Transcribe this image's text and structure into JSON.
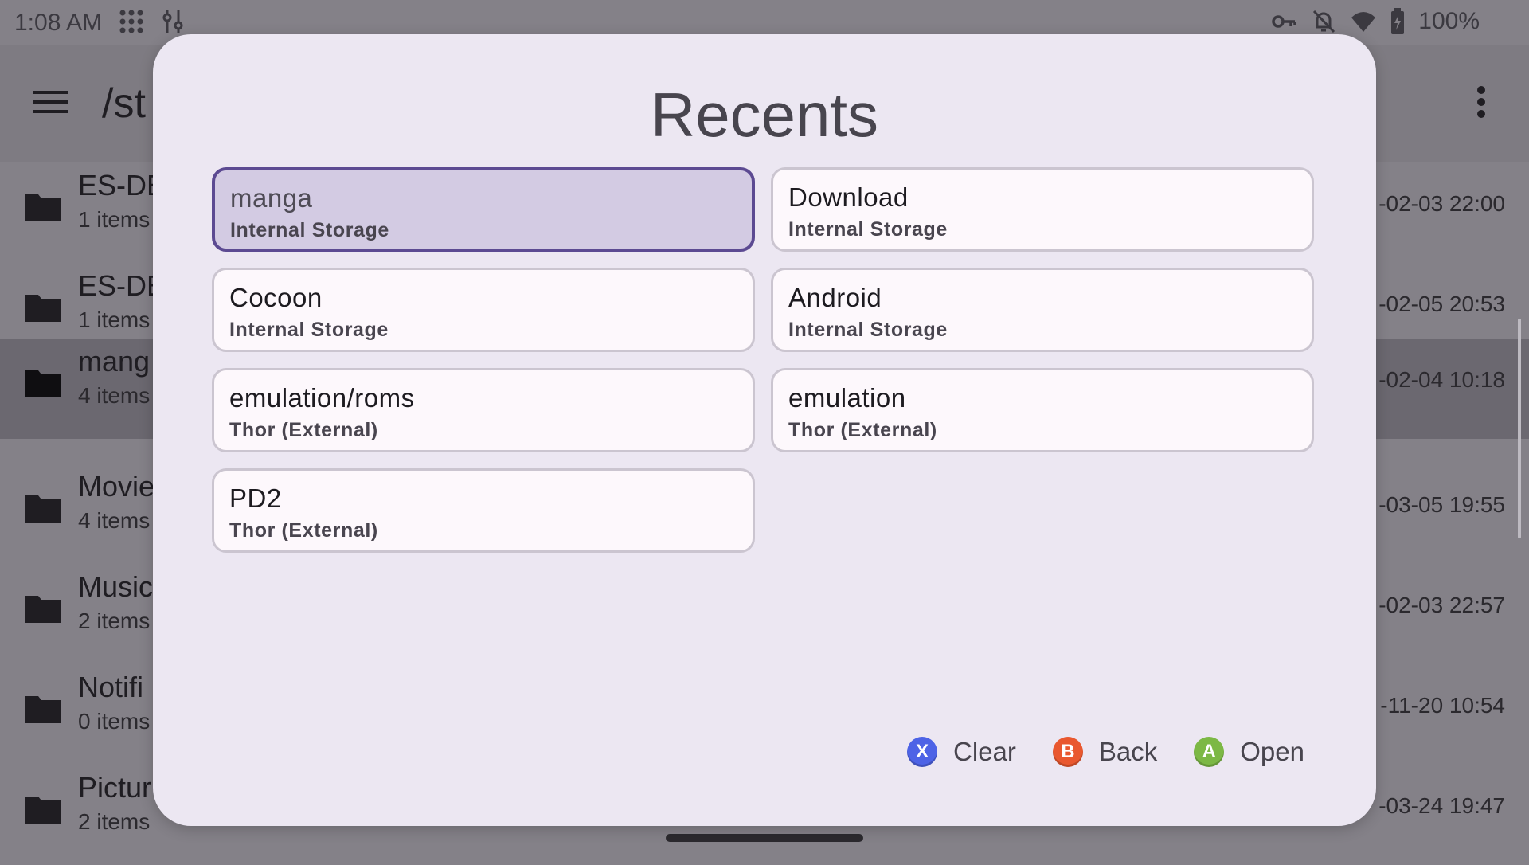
{
  "status": {
    "time": "1:08 AM",
    "battery": "100%"
  },
  "appbar": {
    "path": "/st"
  },
  "files": [
    {
      "name": "ES-DE",
      "count": "1 items",
      "date": "-02-03 22:00"
    },
    {
      "name": "ES-DE",
      "count": "1 items",
      "date": "-02-05 20:53"
    },
    {
      "name": "mang",
      "count": "4 items",
      "date": "-02-04 10:18",
      "selected": true
    },
    {
      "name": "Movie",
      "count": "4 items",
      "date": "-03-05 19:55"
    },
    {
      "name": "Music",
      "count": "2 items",
      "date": "-02-03 22:57"
    },
    {
      "name": "Notifi",
      "count": "0 items",
      "date": "-11-20 10:54"
    },
    {
      "name": "Pictur",
      "count": "2 items",
      "date": "-03-24 19:47"
    }
  ],
  "dialog": {
    "title": "Recents",
    "items": [
      {
        "name": "manga",
        "location": "Internal Storage"
      },
      {
        "name": "Download",
        "location": "Internal Storage"
      },
      {
        "name": "Cocoon",
        "location": "Internal Storage"
      },
      {
        "name": "Android",
        "location": "Internal Storage"
      },
      {
        "name": "emulation/roms",
        "location": "Thor (External)"
      },
      {
        "name": "emulation",
        "location": "Thor (External)"
      },
      {
        "name": "PD2",
        "location": "Thor (External)"
      }
    ],
    "actions": [
      {
        "key": "X",
        "label": "Clear",
        "color": "#4d63e6"
      },
      {
        "key": "B",
        "label": "Back",
        "color": "#e9582f"
      },
      {
        "key": "A",
        "label": "Open",
        "color": "#7cb845"
      }
    ]
  },
  "colors": {
    "focus_border": "#5c4a92",
    "focus_fill": "#d3cbe3",
    "dialog_bg": "#ece7f2"
  }
}
